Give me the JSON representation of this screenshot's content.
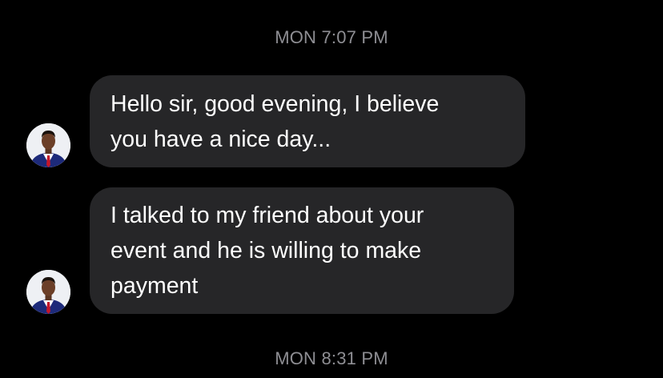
{
  "thread": {
    "timestamp_1": "MON 7:07 PM",
    "timestamp_2": "MON 8:31 PM",
    "messages": [
      {
        "text": "Hello sir, good evening, I believe\nyou have a nice day..."
      },
      {
        "text": "I talked to my friend about your\nevent and he is willing to make\npayment"
      }
    ]
  },
  "colors": {
    "background": "#000000",
    "bubble": "#262628",
    "timestamp": "#8e8e93",
    "text": "#ffffff"
  },
  "icons": {
    "avatar": "user-avatar-photo"
  }
}
